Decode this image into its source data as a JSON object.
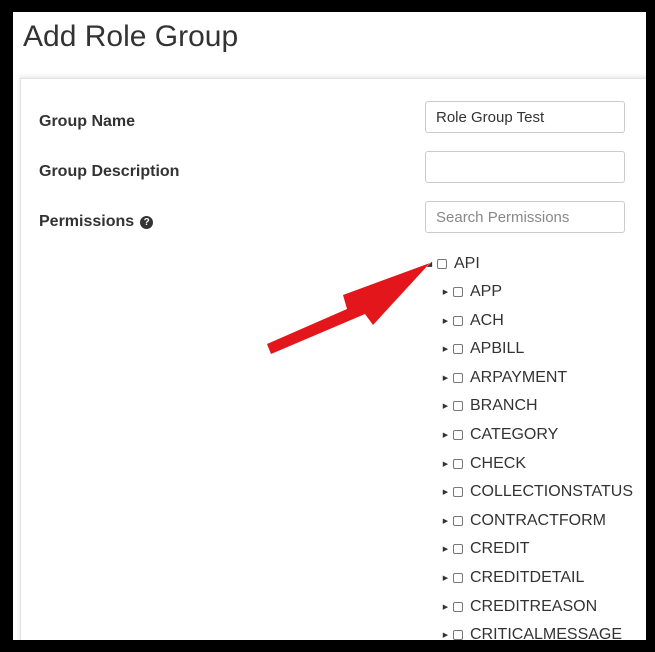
{
  "page_title": "Add Role Group",
  "form": {
    "group_name_label": "Group Name",
    "group_name_value": "Role Group Test",
    "group_description_label": "Group Description",
    "group_description_value": "",
    "permissions_label": "Permissions",
    "help_glyph": "?",
    "search_placeholder": "Search Permissions"
  },
  "tree": {
    "root": {
      "label": "API",
      "expanded": true
    },
    "children": [
      "APP",
      "ACH",
      "APBILL",
      "ARPAYMENT",
      "BRANCH",
      "CATEGORY",
      "CHECK",
      "COLLECTIONSTATUS",
      "CONTRACTFORM",
      "CREDIT",
      "CREDITDETAIL",
      "CREDITREASON",
      "CRITICALMESSAGE"
    ]
  },
  "icons": {
    "collapsed": "triangle-right-icon",
    "expanded": "triangle-down-icon",
    "help": "question-circle-icon",
    "annotation": "red-arrow"
  },
  "colors": {
    "annotation_arrow": "#e3161b",
    "frame": "#000000"
  }
}
